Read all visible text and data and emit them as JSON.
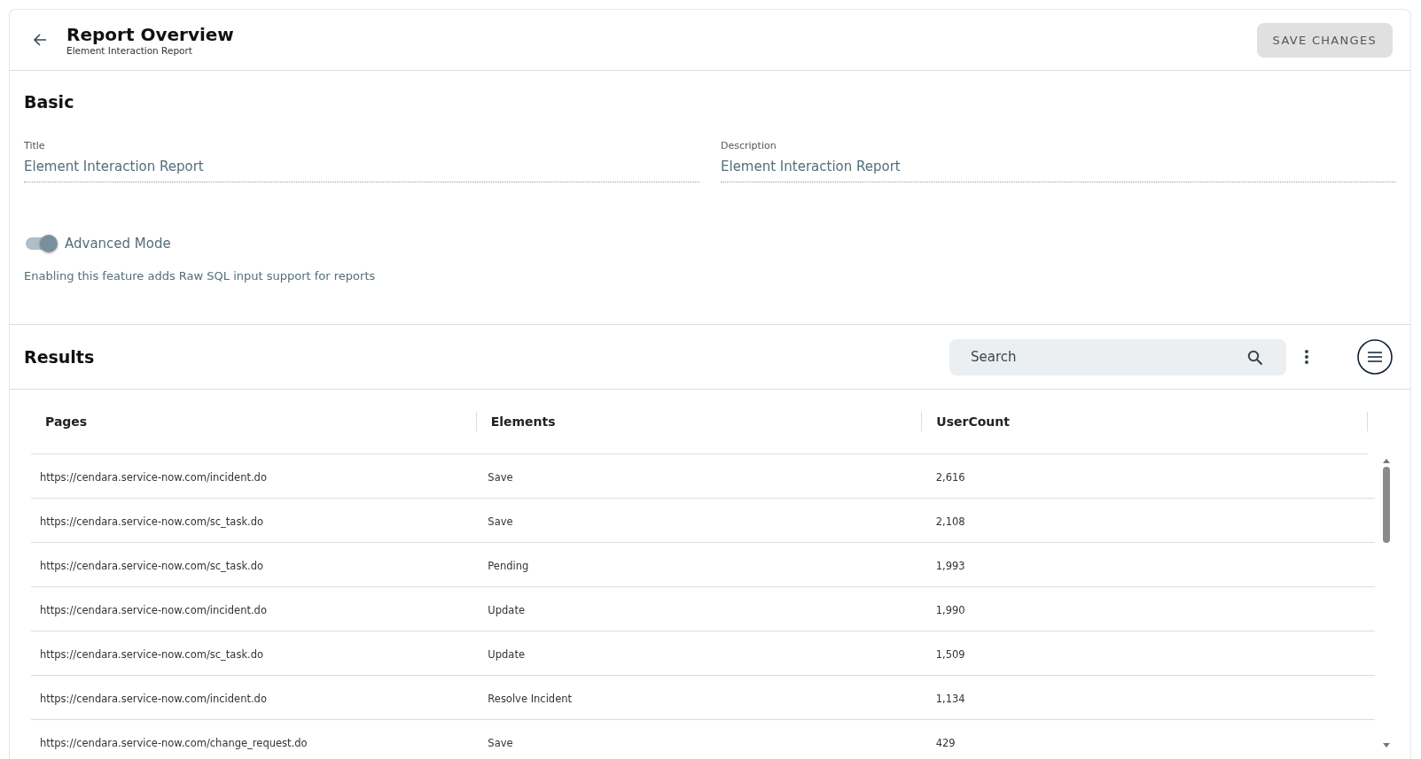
{
  "header": {
    "title": "Report Overview",
    "subtitle": "Element Interaction Report",
    "save_button": {
      "label": "SAVE CHANGES",
      "disabled": true
    }
  },
  "basic": {
    "heading": "Basic",
    "fields": [
      {
        "label": "Title",
        "value": "Element Interaction Report"
      },
      {
        "label": "Description",
        "value": "Element Interaction Report"
      }
    ],
    "advanced_mode": {
      "label": "Advanced Mode",
      "on": true,
      "help": "Enabling this feature adds Raw SQL input support for reports"
    }
  },
  "results": {
    "heading": "Results",
    "search": {
      "placeholder": "Search"
    },
    "table": {
      "columns": [
        "Pages",
        "Elements",
        "UserCount"
      ],
      "rows": [
        [
          "https://cendara.service-now.com/incident.do",
          "Save",
          "2,616"
        ],
        [
          "https://cendara.service-now.com/sc_task.do",
          "Save",
          "2,108"
        ],
        [
          "https://cendara.service-now.com/sc_task.do",
          "Pending",
          "1,993"
        ],
        [
          "https://cendara.service-now.com/incident.do",
          "Update",
          "1,990"
        ],
        [
          "https://cendara.service-now.com/sc_task.do",
          "Update",
          "1,509"
        ],
        [
          "https://cendara.service-now.com/incident.do",
          "Resolve Incident",
          "1,134"
        ],
        [
          "https://cendara.service-now.com/change_request.do",
          "Save",
          "429"
        ]
      ]
    }
  }
}
